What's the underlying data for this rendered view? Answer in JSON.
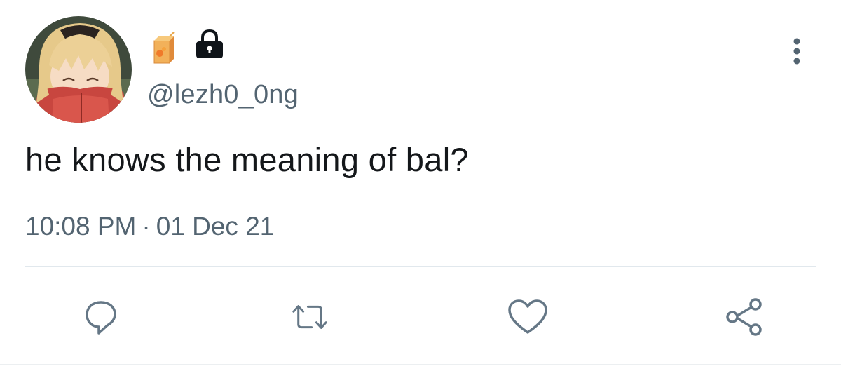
{
  "user": {
    "handle": "@lezh0_0ng",
    "avatar": "anime-character-avatar",
    "name_emoji": "juice-box-emoji",
    "protected_icon": "lock-icon"
  },
  "tweet": {
    "text": "he knows the meaning of bal?",
    "time": "10:08 PM",
    "separator": "·",
    "date": "01 Dec 21"
  },
  "actions": {
    "reply_icon": "reply-icon",
    "retweet_icon": "retweet-icon",
    "like_icon": "heart-icon",
    "share_icon": "share-icon",
    "more_icon": "more-vertical-icon"
  },
  "colors": {
    "text": "#14171a",
    "secondary": "#536471",
    "icon": "#657786",
    "divider": "#e1e8ed"
  }
}
